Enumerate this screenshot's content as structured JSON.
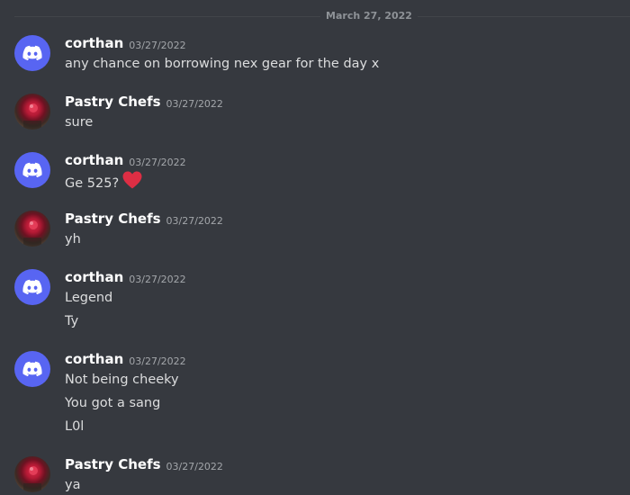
{
  "date_divider": "March 27, 2022",
  "messages": [
    {
      "author": "corthan",
      "avatar": "discord-logo-icon",
      "time": "03/27/2022",
      "lines": [
        "any chance on borrowing nex gear for the day x"
      ]
    },
    {
      "author": "Pastry Chefs",
      "avatar": "pastry-avatar",
      "time": "03/27/2022",
      "lines": [
        "sure"
      ]
    },
    {
      "author": "corthan",
      "avatar": "discord-logo-icon",
      "time": "03/27/2022",
      "lines": [
        "Ge 525?"
      ],
      "emoji": "heart-icon"
    },
    {
      "author": "Pastry Chefs",
      "avatar": "pastry-avatar",
      "time": "03/27/2022",
      "lines": [
        "yh"
      ]
    },
    {
      "author": "corthan",
      "avatar": "discord-logo-icon",
      "time": "03/27/2022",
      "lines": [
        "Legend",
        "Ty"
      ]
    },
    {
      "author": "corthan",
      "avatar": "discord-logo-icon",
      "time": "03/27/2022",
      "lines": [
        "Not being cheeky",
        "You got a sang",
        "L0l"
      ]
    },
    {
      "author": "Pastry Chefs",
      "avatar": "pastry-avatar",
      "time": "03/27/2022",
      "lines": [
        "ya"
      ]
    }
  ],
  "colors": {
    "background": "#36393f",
    "discord_blurple": "#5865f2",
    "heart": "#dd2e44",
    "username": "#ffffff",
    "timestamp": "#a3a6aa",
    "text": "#dcddde"
  }
}
